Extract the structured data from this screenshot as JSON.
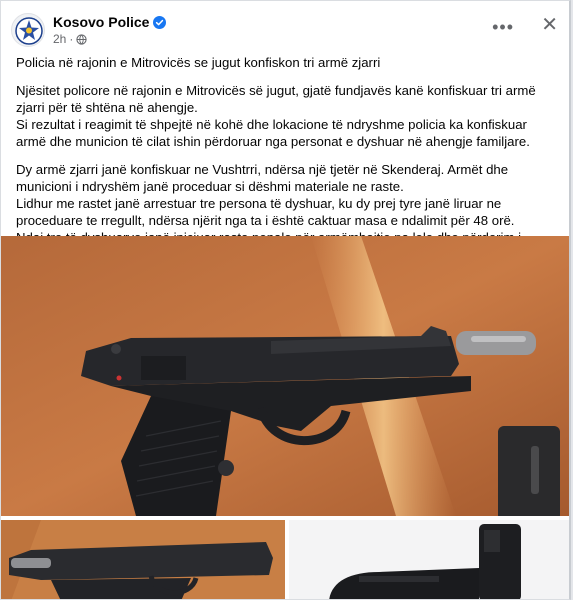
{
  "post": {
    "author": "Kosovo Police",
    "time": "2h",
    "title": "Policia në rajonin e Mitrovicës se jugut konfiskon tri armë zjarri",
    "para1": [
      "Njësitet policore në rajonin e Mitrovicës së jugut, gjatë fundjavës kanë konfiskuar tri armë zjarri për të shtëna në ahengje.",
      "Si rezultat i reagimit të shpejtë në kohë dhe lokacione të ndryshme policia ka konfiskuar armë dhe municion të cilat ishin përdoruar nga personat e dyshuar  në ahengje familjare."
    ],
    "para2": [
      "Dy armë zjarri janë konfiskuar ne Vushtrri, ndërsa një tjetër në Skenderaj. Armët dhe municioni i ndryshëm janë proceduar si dëshmi materiale ne raste.",
      "Lidhur me rastet janë arrestuar tre persona të dyshuar, ku dy prej tyre janë liruar ne proceduare te rregullt, ndërsa njërit nga ta i është caktuar masa e ndalimit për 48 orë.",
      "Ndaj tre të dyshuarve janë iniciuar raste penale për armëmbajtje pa lele dhe  përdorim i armës."
    ]
  },
  "icons": {
    "verified": "verified-badge-icon",
    "privacy": "globe-icon",
    "more": "more-options-icon",
    "close": "close-icon"
  },
  "colors": {
    "verified": "#1877f2",
    "text": "#050505",
    "meta": "#65676b"
  }
}
